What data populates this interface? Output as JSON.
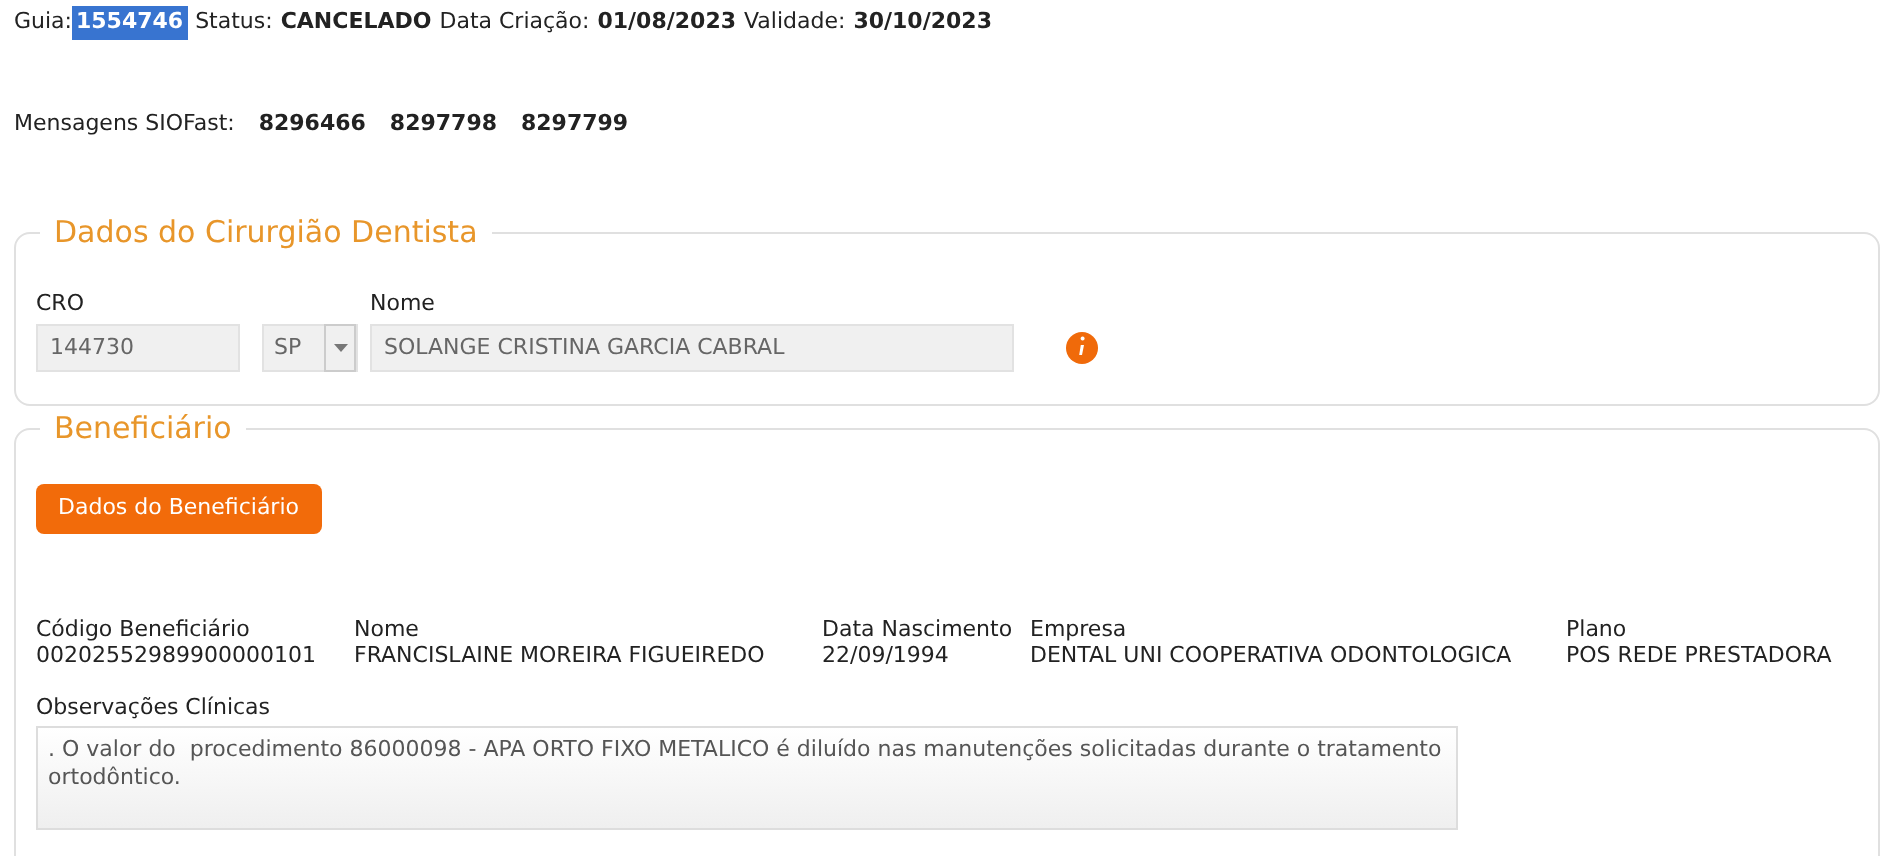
{
  "header": [
    {
      "label": "Guia:",
      "value": "1554746",
      "highlighted": true
    },
    {
      "label": "Status:",
      "value": "CANCELADO",
      "highlighted": false
    },
    {
      "label": "Data Criação:",
      "value": "01/08/2023",
      "highlighted": false
    },
    {
      "label": "Validade:",
      "value": "30/10/2023",
      "highlighted": false
    }
  ],
  "messages": {
    "label": "Mensagens SIOFast:",
    "values": [
      "8296466",
      "8297798",
      "8297799"
    ]
  },
  "dentist": {
    "legend": "Dados do Cirurgião Dentista",
    "cro_label": "CRO",
    "cro": "144730",
    "uf": "SP",
    "name_label": "Nome",
    "name": "SOLANGE CRISTINA GARCIA CABRAL"
  },
  "beneficiary": {
    "legend": "Beneficiário",
    "button": "Dados do Beneficiário",
    "fields": [
      {
        "label": "Código Beneficiário",
        "value": "00202552989900000101"
      },
      {
        "label": "Nome",
        "value": "FRANCISLAINE MOREIRA FIGUEIREDO"
      },
      {
        "label": "Data Nascimento",
        "value": "22/09/1994"
      },
      {
        "label": "Empresa",
        "value": "DENTAL UNI COOPERATIVA ODONTOLOGICA"
      },
      {
        "label": "Plano",
        "value": "POS REDE PRESTADORA"
      }
    ],
    "notes_label": "Observações Clínicas",
    "notes": ". O valor do  procedimento 86000098 - APA ORTO FIXO METALICO é diluído nas manutenções solicitadas durante o tratamento ortodôntico."
  }
}
